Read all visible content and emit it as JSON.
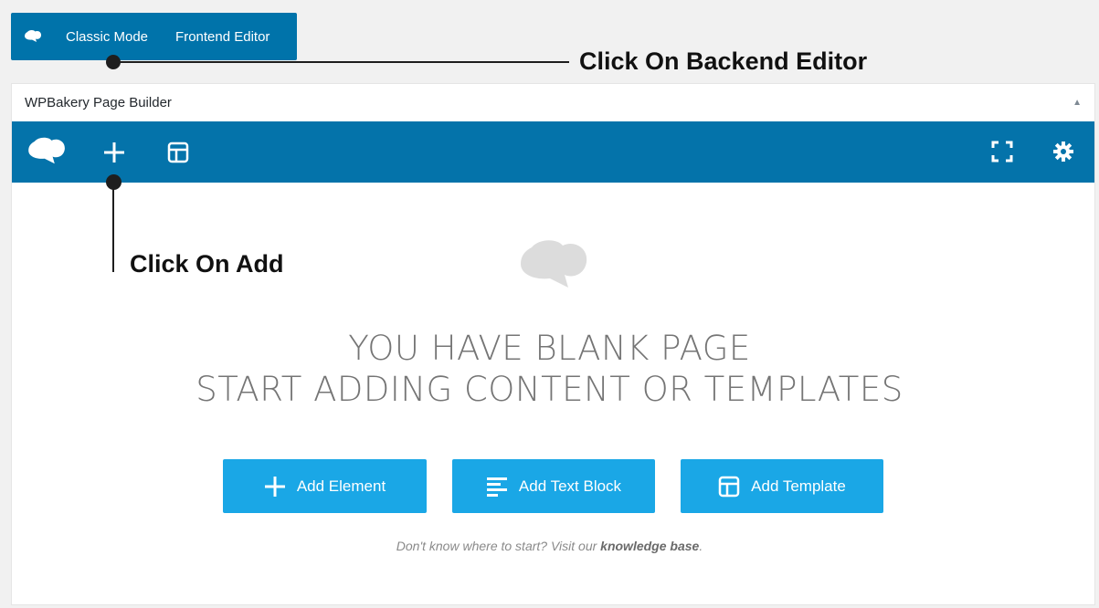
{
  "mode_switcher": {
    "classic_label": "Classic Mode",
    "frontend_label": "Frontend Editor"
  },
  "callouts": {
    "backend": "Click On Backend Editor",
    "add": "Click On Add"
  },
  "panel": {
    "title": "WPBakery Page Builder",
    "collapse_symbol": "▲"
  },
  "toolbar": {
    "icons": [
      "logo-icon",
      "plus-icon",
      "template-icon",
      "fullscreen-icon",
      "gear-icon"
    ],
    "color": "#0473aa"
  },
  "empty_state": {
    "line1": "YOU HAVE BLANK PAGE",
    "line2": "START ADDING CONTENT OR TEMPLATES",
    "buttons": {
      "add_element": "Add Element",
      "add_text_block": "Add Text Block",
      "add_template": "Add Template"
    },
    "button_color": "#1aa7e6",
    "help_prefix": "Don't know where to start? Visit our ",
    "help_link": "knowledge base",
    "help_suffix": "."
  }
}
